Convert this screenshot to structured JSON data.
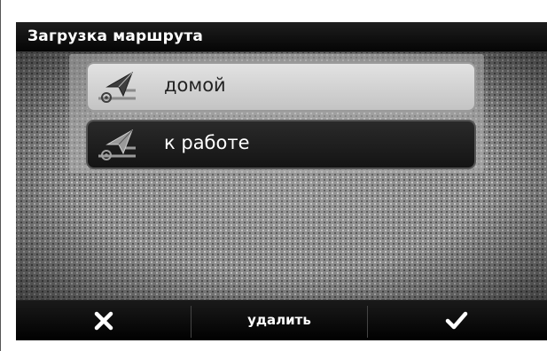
{
  "window": {
    "title": "Загрузка маршрута"
  },
  "routes": [
    {
      "label": "домой",
      "icon": "route-flag-icon",
      "selected": false
    },
    {
      "label": "к работе",
      "icon": "route-flag-icon",
      "selected": true
    }
  ],
  "toolbar": {
    "cancel_icon": "close-icon",
    "delete_label": "удалить",
    "confirm_icon": "checkmark-icon"
  },
  "colors": {
    "selected_bg": "#1c1c1c",
    "item_bg": "#d4d4d4",
    "bar_bg": "#000000"
  }
}
